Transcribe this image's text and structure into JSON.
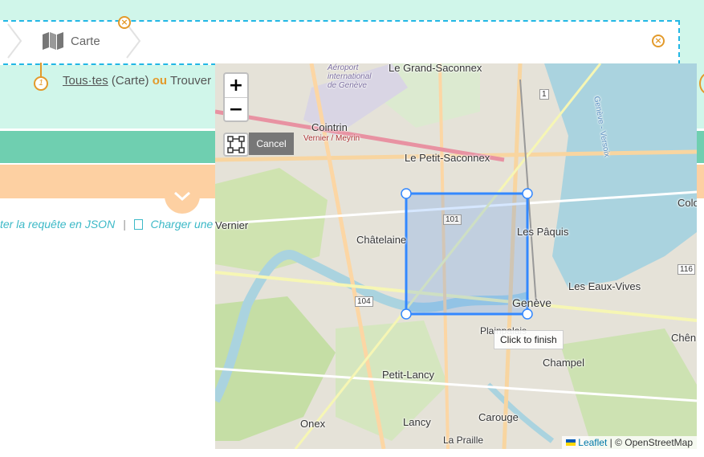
{
  "breadcrumb": {
    "crumb_label": "Carte",
    "icon": "map-icon"
  },
  "query_line": {
    "step_number": "1",
    "all_link": "Tous·tes",
    "paren_text": "(Carte)",
    "or_text": "ou",
    "find_text": "Trouver :"
  },
  "links": {
    "left_link": "ter la requête en JSON",
    "separator": "|",
    "right_link": "Charger une"
  },
  "map": {
    "zoom_in": "+",
    "zoom_out": "−",
    "cancel": "Cancel",
    "tooltip": "Click to finish",
    "attribution_leaflet": "Leaflet",
    "attribution_rest": "| © OpenStreetMap",
    "places": {
      "grand_saconnex": "Le Grand-Saconnex",
      "aeroport": "Aéroport international de Genève",
      "cointrin": "Cointrin",
      "vernier_meyrin": "Vernier / Meyrin",
      "petit_saconnex": "Le Petit-Saconnex",
      "chatelaine": "Châtelaine",
      "vernier": "Vernier",
      "les_paquis": "Les Pâquis",
      "les_eaux_vives": "Les Eaux-Vives",
      "geneve": "Genève",
      "plainpalais": "Plainpalais",
      "champel": "Champel",
      "petit_lancy": "Petit-Lancy",
      "onex": "Onex",
      "lancy": "Lancy",
      "carouge": "Carouge",
      "la_praille": "La Praille",
      "cologny": "Colo",
      "chene": "Chên",
      "geneve_versoix": "Genève - Versoix"
    },
    "road_numbers": {
      "r1": "1",
      "r101": "101",
      "r104": "104",
      "r116": "116"
    }
  },
  "colors": {
    "accent_orange": "#e39a2b",
    "mint": "#d0f6ea",
    "teal": "#6fcfb0",
    "peach": "#fdd0a2",
    "link": "#3cb9c7",
    "selection": "#3388ff"
  }
}
